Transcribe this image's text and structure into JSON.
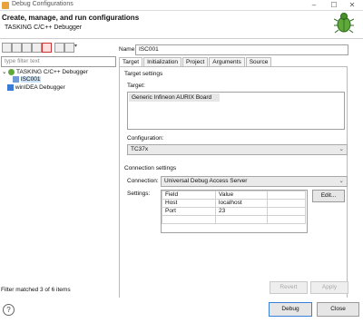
{
  "window": {
    "title": "Debug Configurations",
    "min": "–",
    "max": "☐",
    "close": "✕"
  },
  "header": {
    "title": "Create, manage, and run configurations",
    "subtitle": "TASKING C/C++ Debugger"
  },
  "left": {
    "filter_placeholder": "type filter text",
    "tree": [
      {
        "label": "TASKING C/C++ Debugger",
        "expander": "⌄"
      },
      {
        "label": "ISC001"
      },
      {
        "label": "winIDEA Debugger"
      }
    ],
    "status": "Filter matched 3 of 6 items"
  },
  "config": {
    "name_label": "Name:",
    "name_value": "ISC001",
    "tabs": [
      "Target",
      "Initialization",
      "Project",
      "Arguments",
      "Source"
    ],
    "target_settings_label": "Target settings",
    "target_label": "Target:",
    "target_list": [
      "Generic Infineon AURIX Board"
    ],
    "configuration_label": "Configuration:",
    "configuration_value": "TC37x",
    "connection_settings_label": "Connection settings",
    "connection_label": "Connection:",
    "connection_value": "Universal Debug Access Server",
    "settings_label": "Settings:",
    "settings_headers": [
      "Field",
      "Value"
    ],
    "settings_rows": [
      [
        "Host",
        "localhost"
      ],
      [
        "Port",
        "23"
      ]
    ],
    "edit_button": "Edit...",
    "revert_button": "Revert",
    "apply_button": "Apply"
  },
  "footer": {
    "help": "?",
    "debug_button": "Debug",
    "close_button": "Close"
  }
}
